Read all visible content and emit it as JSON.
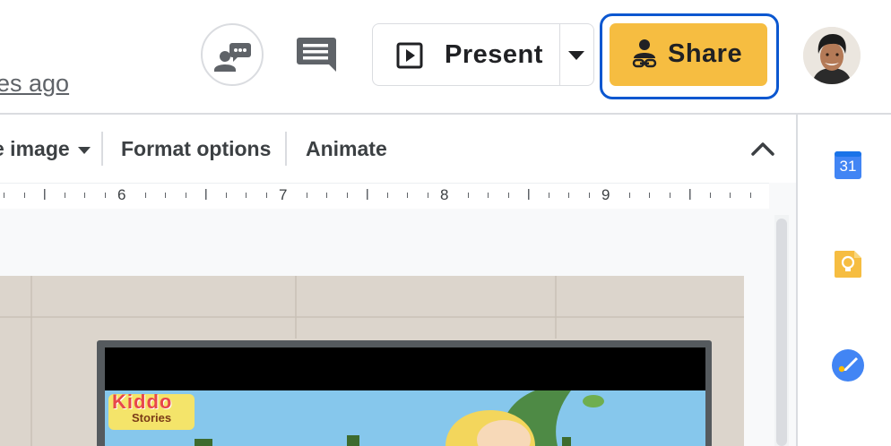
{
  "header": {
    "last_edit": "es ago",
    "present_label": "Present",
    "share_label": "Share"
  },
  "toolbar": {
    "replace_image": "e image",
    "format_options": "Format options",
    "animate": "Animate"
  },
  "ruler": {
    "labels": [
      "6",
      "7",
      "8",
      "9"
    ]
  },
  "slide_image": {
    "logo_line1": "Kiddo",
    "logo_line2": "Stories"
  },
  "side_panel": {
    "calendar_day": "31"
  },
  "colors": {
    "share_bg": "#f6bd41",
    "share_focus_ring": "#0b57d0",
    "calendar_blue": "#4285f4",
    "keep_yellow": "#f6bd41",
    "tasks_blue": "#4285f4"
  },
  "icons": {
    "activity": "activity-dashboard-icon",
    "comment": "comment-icon",
    "present": "present-slideshow-icon",
    "dropdown": "caret-down-icon",
    "share": "share-lock-person-icon",
    "collapse": "chevron-up-icon",
    "calendar": "google-calendar-icon",
    "keep": "google-keep-icon",
    "tasks": "google-tasks-icon"
  }
}
